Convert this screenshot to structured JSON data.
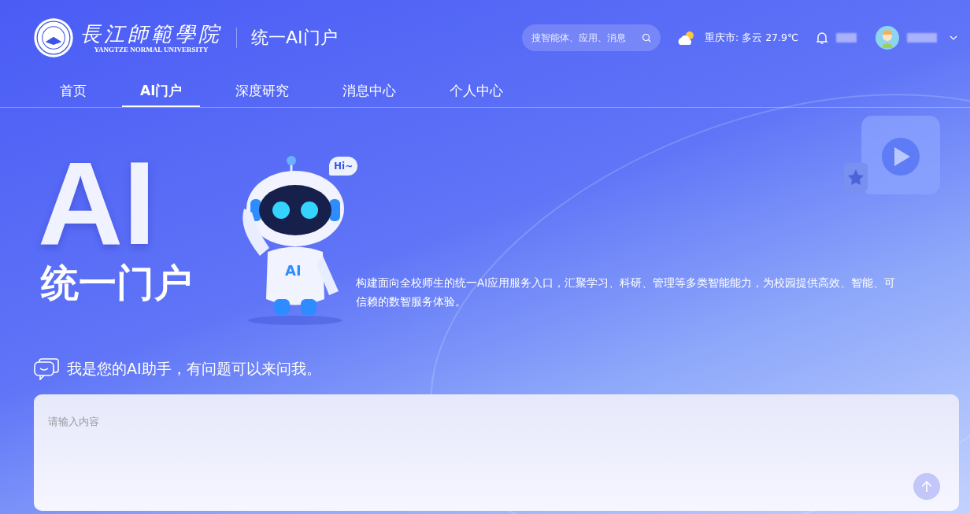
{
  "header": {
    "logo": {
      "name_cn": "長江師範學院",
      "name_en": "YANGTZE NORMAL UNIVERSITY"
    },
    "portal_title": "统一AI门户",
    "search": {
      "placeholder": "搜智能体、应用、消息"
    },
    "weather": "重庆市: 多云 27.9℃"
  },
  "tabs": [
    {
      "label": "首页",
      "selected": false
    },
    {
      "label": "AI门户",
      "selected": true
    },
    {
      "label": "深度研究",
      "selected": false
    },
    {
      "label": "消息中心",
      "selected": false
    },
    {
      "label": "个人中心",
      "selected": false
    }
  ],
  "hero": {
    "big_title": "AI",
    "subtitle": "统一门户",
    "robot_bubble": "Hi~",
    "robot_badge": "AI",
    "description": "构建面向全校师生的统一AI应用服务入口，汇聚学习、科研、管理等多类智能能力，为校园提供高效、智能、可信赖的数智服务体验。"
  },
  "assistant": {
    "title": "我是您的AI助手，有问题可以来问我。",
    "input": {
      "placeholder": "请输入内容"
    }
  }
}
